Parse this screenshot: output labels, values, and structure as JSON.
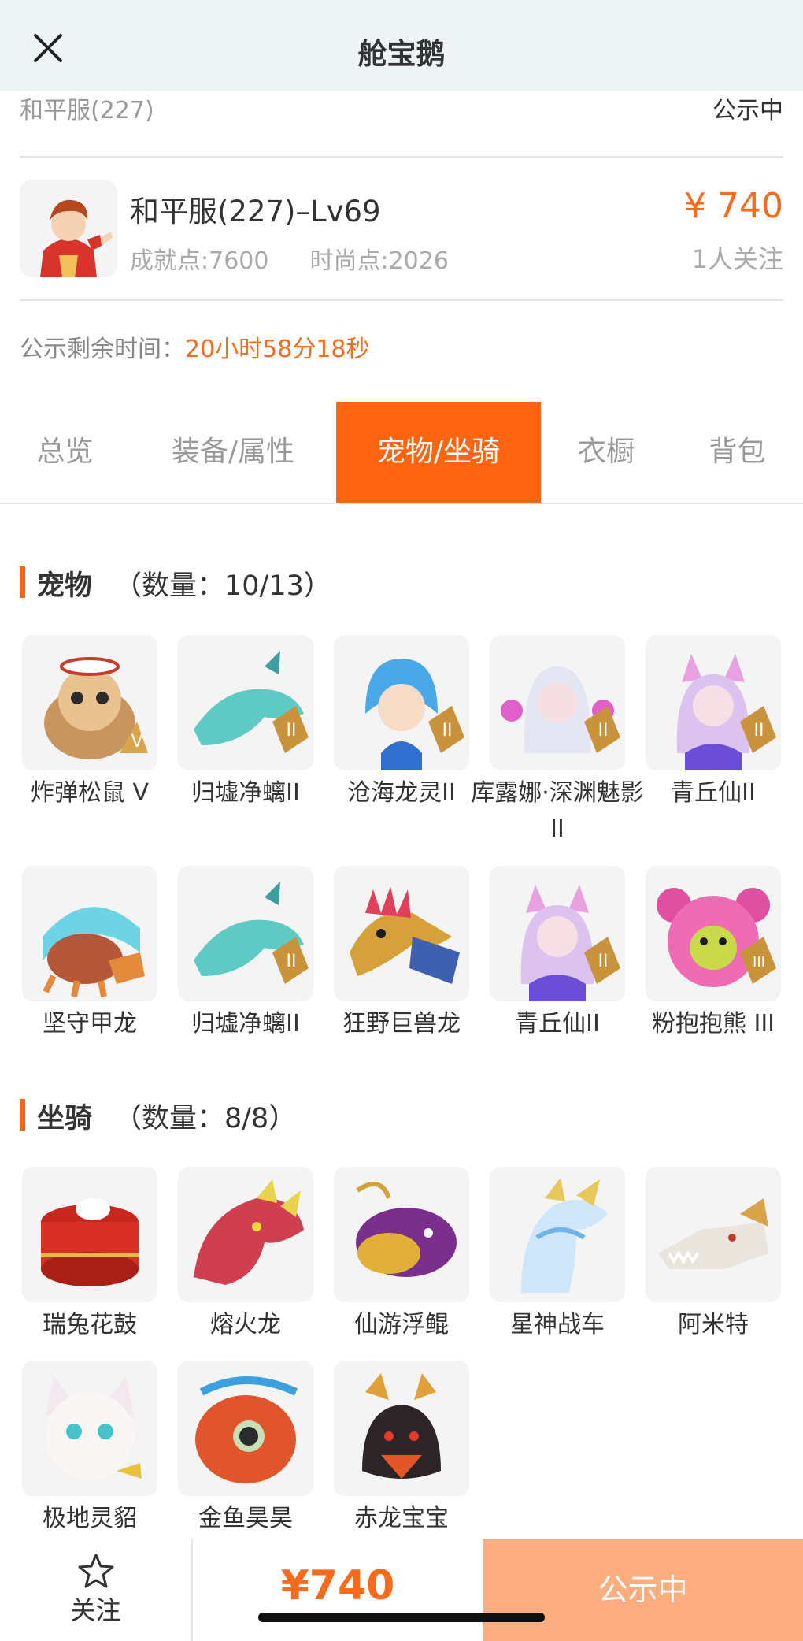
{
  "header": {
    "title": "舱宝鹅",
    "close_icon": "close-icon"
  },
  "server_row": {
    "server": "和平服(227)",
    "status": "公示中"
  },
  "account": {
    "title": "和平服(227)–Lv69",
    "achievement": "成就点:7600",
    "fashion": "时尚点:2026",
    "price": "¥ 740",
    "followers": "1人关注"
  },
  "countdown": {
    "label": "公示剩余时间：",
    "value": "20小时58分18秒"
  },
  "tabs": [
    "总览",
    "装备/属性",
    "宠物/坐骑",
    "衣橱",
    "背包"
  ],
  "active_tab": "宠物/坐骑",
  "pets": {
    "title": "宠物",
    "count": "（数量：10/13）",
    "items": [
      {
        "name": "炸弹松鼠 V",
        "badge": "V"
      },
      {
        "name": "归墟净螭II",
        "badge": "II"
      },
      {
        "name": "沧海龙灵II",
        "badge": "II"
      },
      {
        "name": "库露娜·深渊魅影II",
        "badge": "II"
      },
      {
        "name": "青丘仙II",
        "badge": "II"
      },
      {
        "name": "坚守甲龙",
        "badge": ""
      },
      {
        "name": "归墟净螭II",
        "badge": "II"
      },
      {
        "name": "狂野巨兽龙",
        "badge": ""
      },
      {
        "name": "青丘仙II",
        "badge": "II"
      },
      {
        "name": "粉抱抱熊 III",
        "badge": "III"
      }
    ]
  },
  "mounts": {
    "title": "坐骑",
    "count": "（数量：8/8）",
    "items": [
      {
        "name": "瑞兔花鼓"
      },
      {
        "name": "熔火龙"
      },
      {
        "name": "仙游浮鲲"
      },
      {
        "name": "星神战车"
      },
      {
        "name": "阿米特"
      },
      {
        "name": "极地灵貂"
      },
      {
        "name": "金鱼昊昊"
      },
      {
        "name": "赤龙宝宝"
      }
    ]
  },
  "bottom_bar": {
    "follow_label": "关注",
    "price": "¥740",
    "status_button": "公示中"
  },
  "colors": {
    "accent": "#ff6410",
    "price": "#f86b1d",
    "status_button": "#fbad7f"
  }
}
